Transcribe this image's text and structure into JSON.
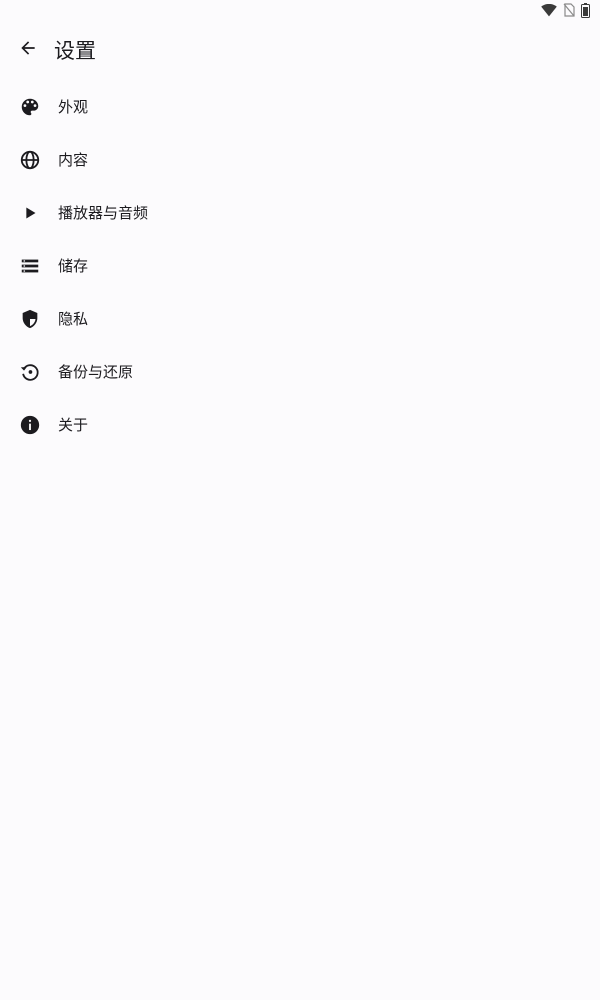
{
  "status_bar": {
    "icons": [
      "wifi-icon",
      "no-sim-icon",
      "battery-icon"
    ]
  },
  "app_bar": {
    "back_icon": "arrow-back-icon",
    "title": "设置"
  },
  "settings": {
    "items": [
      {
        "label": "外观",
        "icon": "palette-icon"
      },
      {
        "label": "内容",
        "icon": "globe-icon"
      },
      {
        "label": "播放器与音频",
        "icon": "play-icon"
      },
      {
        "label": "储存",
        "icon": "storage-list-icon"
      },
      {
        "label": "隐私",
        "icon": "shield-icon"
      },
      {
        "label": "备份与还原",
        "icon": "restore-icon"
      },
      {
        "label": "关于",
        "icon": "info-icon"
      }
    ]
  },
  "colors": {
    "background": "#fcfbfd",
    "text": "#1c1b1f",
    "icon": "#1c1b1f"
  }
}
